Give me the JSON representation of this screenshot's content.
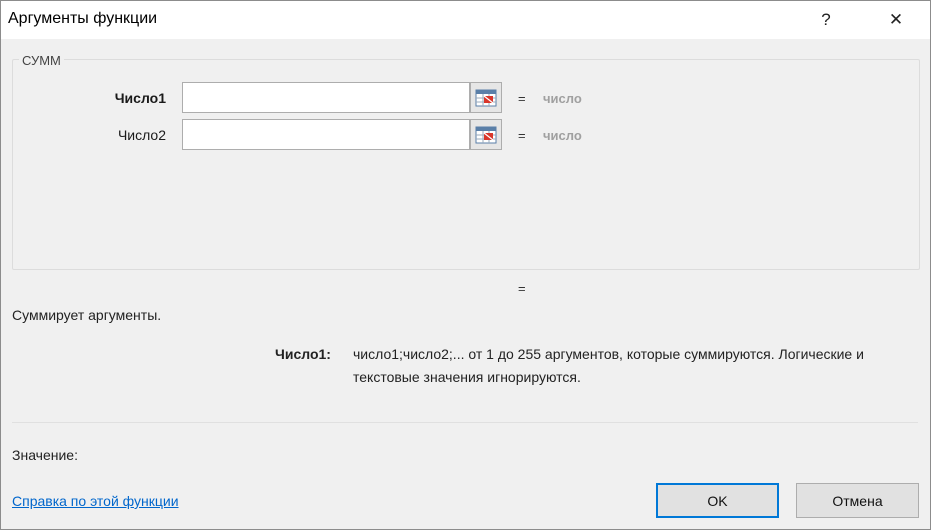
{
  "window": {
    "title": "Аргументы функции",
    "help_glyph": "?",
    "close_glyph": "✕"
  },
  "function_group": {
    "name": "СУММ",
    "args": [
      {
        "label": "Число1",
        "value": "",
        "equals": "=",
        "result": "число"
      },
      {
        "label": "Число2",
        "value": "",
        "equals": "=",
        "result": "число"
      }
    ]
  },
  "formula_result": {
    "equals": "=",
    "value": ""
  },
  "description": "Суммирует аргументы.",
  "arg_help": {
    "name": "Число1:",
    "line1": "число1;число2;... от 1 до 255 аргументов, которые суммируются. Логические и",
    "line2": "текстовые значения игнорируются."
  },
  "value_label": "Значение:",
  "help_link": "Справка по этой функции",
  "buttons": {
    "ok": "OK",
    "cancel": "Отмена"
  },
  "icons": {
    "reference": "range-select-icon",
    "help": "question-mark-icon",
    "close": "close-icon"
  },
  "colors": {
    "accent": "#0078d7",
    "link": "#0066cc",
    "muted_result": "#a0a0a0"
  }
}
